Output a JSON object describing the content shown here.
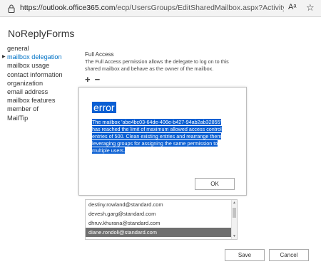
{
  "browser": {
    "url_host": "https://outlook.office365.com",
    "url_path": "/ecp/UsersGroups/EditSharedMailbox.aspx?ActivityCorrelationI...",
    "read_aloud_label": "Aᵃ",
    "favorite_glyph": "☆",
    "lock_icon": "lock-icon"
  },
  "page": {
    "title": "NoReplyForms"
  },
  "nav": {
    "items": [
      {
        "label": "general"
      },
      {
        "label": "mailbox delegation"
      },
      {
        "label": "mailbox usage"
      },
      {
        "label": "contact information"
      },
      {
        "label": "organization"
      },
      {
        "label": "email address"
      },
      {
        "label": "mailbox features"
      },
      {
        "label": "member of"
      },
      {
        "label": "MailTip"
      }
    ],
    "active_index": 1
  },
  "full_access": {
    "label": "Full Access",
    "description": "The Full Access permission allows the delegate to log on to this shared mailbox and behave as the owner of the mailbox.",
    "add_glyph": "+",
    "remove_glyph": "−"
  },
  "members": [
    "destiny.rowland@standard.com",
    "devesh.garg@standard.com",
    "dhruv.khurana@standard.com",
    "diane.rondoli@standard.com"
  ],
  "dialog": {
    "title": "error",
    "message": "The mailbox 'abe4bc03-64de-406e-b427-94ab2ab32855' has reached the limit of maximum allowed access control entries of 500. Clean existing entries and rearrange them leveraging groups for assigning the same permission to multiple users.",
    "ok_label": "OK",
    "highlight_color": "#0a5fd3"
  },
  "footer": {
    "save_label": "Save",
    "cancel_label": "Cancel"
  }
}
